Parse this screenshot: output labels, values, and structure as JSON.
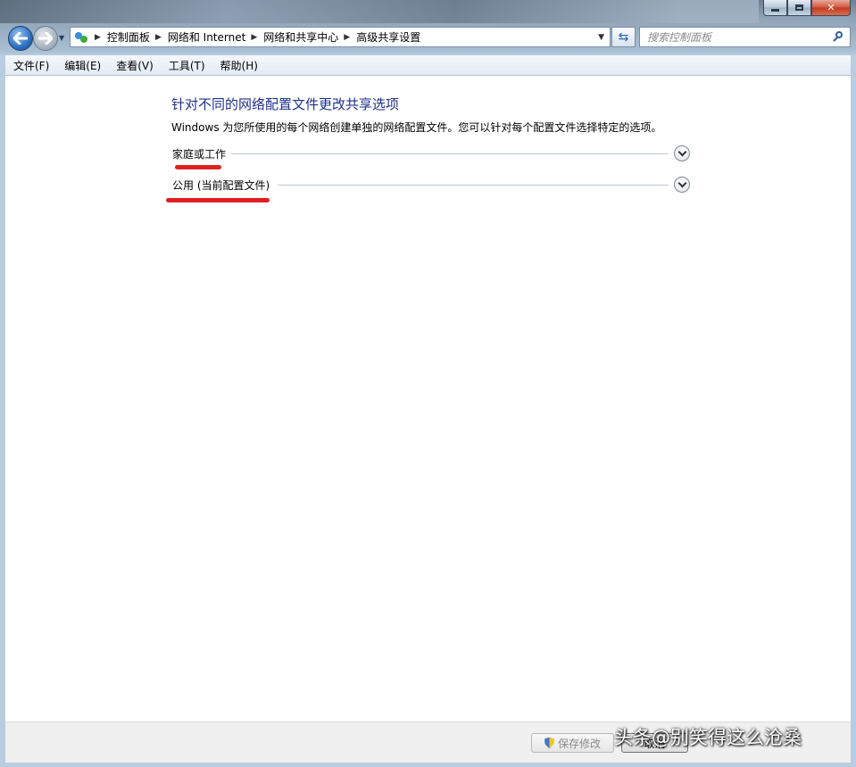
{
  "window": {
    "caption": {
      "minimize": "minimize",
      "maximize": "maximize",
      "close": "✕"
    }
  },
  "nav": {
    "breadcrumbs": [
      "控制面板",
      "网络和 Internet",
      "网络和共享中心",
      "高级共享设置"
    ],
    "search_placeholder": "搜索控制面板"
  },
  "menu": [
    "文件(F)",
    "编辑(E)",
    "查看(V)",
    "工具(T)",
    "帮助(H)"
  ],
  "main": {
    "title": "针对不同的网络配置文件更改共享选项",
    "description": "Windows 为您所使用的每个网络创建单独的网络配置文件。您可以针对每个配置文件选择特定的选项。",
    "sections": [
      {
        "label": "家庭或工作",
        "expanded": false
      },
      {
        "label": "公用 (当前配置文件)",
        "expanded": false
      }
    ]
  },
  "footer": {
    "save_label": "保存修改",
    "cancel_label": "取消"
  },
  "watermark": "头条@别笑得这么沧桑",
  "colors": {
    "title_blue": "#1e3287",
    "annotation_red": "#e02020"
  }
}
